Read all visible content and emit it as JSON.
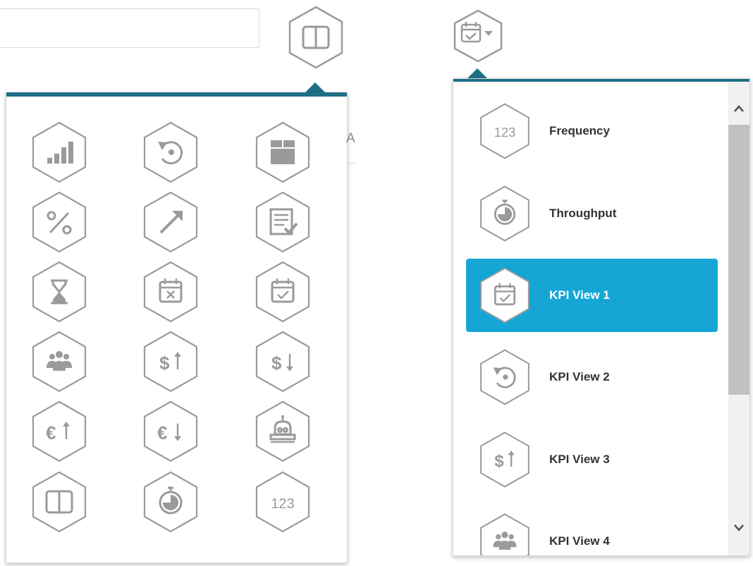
{
  "left_menu": {
    "icons": [
      "bar-chart-icon",
      "rotate-left-icon",
      "box-icon",
      "percent-icon",
      "arrow-up-right-icon",
      "checklist-icon",
      "hourglass-icon",
      "calendar-x-icon",
      "calendar-check-icon",
      "users-icon",
      "dollar-up-icon",
      "dollar-down-icon",
      "euro-up-icon",
      "euro-down-icon",
      "robot-icon",
      "columns-icon",
      "stopwatch-icon",
      "number-123-icon"
    ],
    "icon_text_123": "123",
    "partial_letter": "A"
  },
  "right_list": {
    "items": [
      {
        "label": "Frequency",
        "icon": "number-123-icon",
        "icon_text": "123"
      },
      {
        "label": "Throughput",
        "icon": "stopwatch-icon"
      },
      {
        "label": "KPI View 1",
        "icon": "calendar-check-icon",
        "selected": true
      },
      {
        "label": "KPI View 2",
        "icon": "rotate-left-icon"
      },
      {
        "label": "KPI View 3",
        "icon": "dollar-up-icon"
      },
      {
        "label": "KPI View 4",
        "icon": "users-icon"
      }
    ]
  },
  "colors": {
    "accent_bar": "#1e6e86",
    "selected_bg": "#15a6d6",
    "icon_gray": "#9a9a9a"
  }
}
